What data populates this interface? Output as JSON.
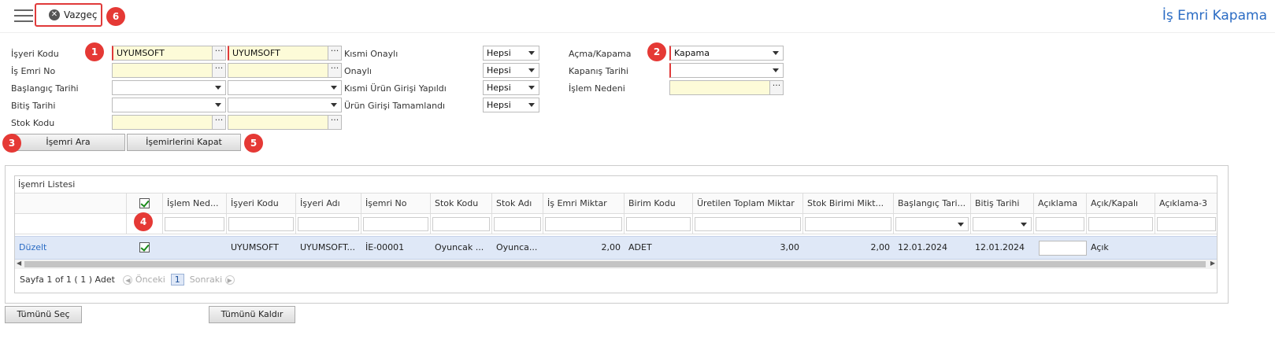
{
  "header": {
    "cancel_label": "Vazgeç",
    "page_title": "İş Emri Kapama"
  },
  "badges": [
    "1",
    "2",
    "3",
    "4",
    "5",
    "6"
  ],
  "form": {
    "isyeri_kodu": {
      "label": "İşyeri Kodu",
      "from": "UYUMSOFT",
      "to": "UYUMSOFT"
    },
    "is_emri_no": {
      "label": "İş Emri No"
    },
    "baslangic_tarihi": {
      "label": "Başlangıç Tarihi"
    },
    "bitis_tarihi": {
      "label": "Bitiş Tarihi"
    },
    "stok_kodu": {
      "label": "Stok Kodu"
    },
    "kismi_onayli": {
      "label": "Kısmi Onaylı",
      "value": "Hepsi"
    },
    "onayli": {
      "label": "Onaylı",
      "value": "Hepsi"
    },
    "kismi_urun_girisi": {
      "label": "Kısmi Ürün Girişi Yapıldı",
      "value": "Hepsi"
    },
    "urun_girisi_tamam": {
      "label": "Ürün Girişi Tamamlandı",
      "value": "Hepsi"
    },
    "acma_kapama": {
      "label": "Açma/Kapama",
      "value": "Kapama"
    },
    "kapanis_tarihi": {
      "label": "Kapanış Tarihi"
    },
    "islem_nedeni": {
      "label": "İşlem Nedeni"
    }
  },
  "buttons": {
    "search": "İşemri Ara",
    "close_orders": "İşemirlerini Kapat",
    "select_all": "Tümünü Seç",
    "deselect_all": "Tümünü Kaldır"
  },
  "grid": {
    "title": "İşemri Listesi",
    "columns": [
      "İşlem Ned...",
      "İşyeri Kodu",
      "İşyeri Adı",
      "İşemri No",
      "Stok Kodu",
      "Stok Adı",
      "İş Emri Miktar",
      "Birim Kodu",
      "Üretilen Toplam Miktar",
      "Stok Birimi Mikt...",
      "Başlangıç Tari...",
      "Bitiş Tarihi",
      "Açıklama",
      "Açık/Kapalı",
      "Açıklama-3"
    ],
    "row": {
      "edit": "Düzelt",
      "islem_nedeni": "",
      "isyeri_kodu": "UYUMSOFT",
      "isyeri_adi": "UYUMSOFT...",
      "isemri_no": "İE-00001",
      "stok_kodu": "Oyuncak ...",
      "stok_adi": "Oyunca...",
      "miktar": "2,00",
      "birim": "ADET",
      "uretilen": "3,00",
      "stok_birimi": "2,00",
      "baslangic": "12.01.2024",
      "bitis": "12.01.2024",
      "acik_kapali": "Açık"
    },
    "pager": {
      "info": "Sayfa 1 of 1 ( 1 ) Adet",
      "prev": "Önceki",
      "page": "1",
      "next": "Sonraki"
    }
  }
}
